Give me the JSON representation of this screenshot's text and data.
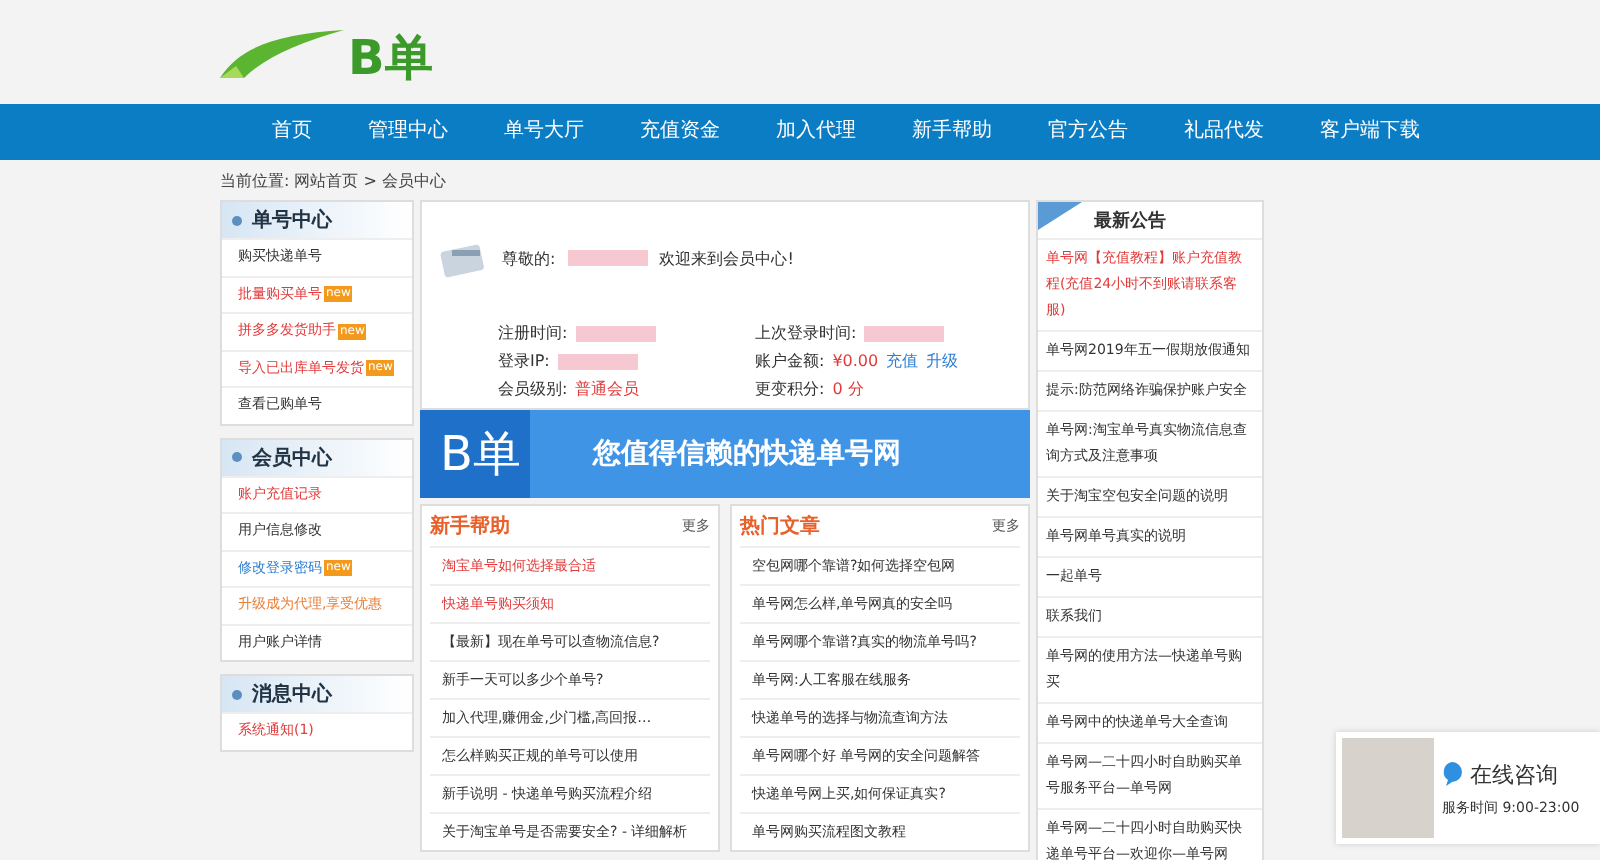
{
  "header": {
    "logo_text": "B单"
  },
  "nav": [
    {
      "label": "首页"
    },
    {
      "label": "管理中心"
    },
    {
      "label": "单号大厅"
    },
    {
      "label": "充值资金"
    },
    {
      "label": "加入代理"
    },
    {
      "label": "新手帮助"
    },
    {
      "label": "官方公告"
    },
    {
      "label": "礼品代发"
    },
    {
      "label": "客户端下载"
    }
  ],
  "breadcrumb": "当前位置: 网站首页 > 会员中心",
  "sidebar": [
    {
      "title": "单号中心",
      "items": [
        {
          "label": "购买快递单号",
          "color": "#333333"
        },
        {
          "label": "批量购买单号",
          "color": "#e23a3a",
          "badge": "new"
        },
        {
          "label": "拼多多发货助手",
          "color": "#e23a3a",
          "badge": "new"
        },
        {
          "label": "导入已出库单号发货",
          "color": "#e23a3a",
          "badge": "new"
        },
        {
          "label": "查看已购单号",
          "color": "#333333"
        }
      ]
    },
    {
      "title": "会员中心",
      "items": [
        {
          "label": "账户充值记录",
          "color": "#e23a3a"
        },
        {
          "label": "用户信息修改",
          "color": "#333333"
        },
        {
          "label": "修改登录密码",
          "color": "#2f7fd0",
          "badge": "new"
        },
        {
          "label": "升级成为代理,享受优惠",
          "color": "#e8803a"
        },
        {
          "label": "用户账户详情",
          "color": "#333333"
        }
      ]
    },
    {
      "title": "消息中心",
      "items": [
        {
          "label": "系统通知(1)",
          "color": "#e23a3a"
        }
      ]
    }
  ],
  "welcome": {
    "prefix": "尊敬的:",
    "suffix": "欢迎来到会员中心!"
  },
  "info": [
    {
      "label": "注册时间:"
    },
    {
      "label": "上次登录时间:"
    },
    {
      "label": "登录IP:"
    },
    {
      "label": "账户金额:",
      "value": "¥0.00",
      "links": [
        "充值",
        "升级"
      ]
    },
    {
      "label": "会员级别:",
      "value": "普通会员"
    },
    {
      "label": "更变积分:",
      "value": "0 分"
    }
  ],
  "banner": {
    "logo_text": "B单",
    "slogan": "您值得信赖的快递单号网"
  },
  "lists": [
    {
      "title": "新手帮助",
      "more": "更多",
      "items": [
        {
          "label": "淘宝单号如何选择最合适",
          "color": "#e23a3a"
        },
        {
          "label": "快递单号购买须知",
          "color": "#e23a3a"
        },
        {
          "label": "【最新】现在单号可以查物流信息?",
          "color": "#333333"
        },
        {
          "label": "新手一天可以多少个单号?",
          "color": "#333333"
        },
        {
          "label": "加入代理,赚佣金,少门槛,高回报…",
          "color": "#333333"
        },
        {
          "label": "怎么样购买正规的单号可以使用",
          "color": "#333333"
        },
        {
          "label": "新手说明 - 快递单号购买流程介绍",
          "color": "#333333"
        },
        {
          "label": "关于淘宝单号是否需要安全? - 详细解析",
          "color": "#333333"
        }
      ]
    },
    {
      "title": "热门文章",
      "more": "更多",
      "items": [
        {
          "label": "空包网哪个靠谱?如何选择空包网",
          "color": "#333333"
        },
        {
          "label": "单号网怎么样,单号网真的安全吗",
          "color": "#333333"
        },
        {
          "label": "单号网哪个靠谱?真实的物流单号吗?",
          "color": "#333333"
        },
        {
          "label": "单号网:人工客服在线服务",
          "color": "#333333"
        },
        {
          "label": "快递单号的选择与物流查询方法",
          "color": "#333333"
        },
        {
          "label": "单号网哪个好 单号网的安全问题解答",
          "color": "#333333"
        },
        {
          "label": "快递单号网上买,如何保证真实?",
          "color": "#333333"
        },
        {
          "label": "单号网购买流程图文教程",
          "color": "#333333"
        }
      ]
    }
  ],
  "notices": {
    "title": "最新公告",
    "items": [
      {
        "label": "单号网【充值教程】账户充值教程(充值24小时不到账请联系客服)",
        "color": "#e23a3a"
      },
      {
        "label": "单号网2019年五一假期放假通知",
        "color": "#333333"
      },
      {
        "label": "提示:防范网络诈骗保护账户安全",
        "color": "#333333"
      },
      {
        "label": "单号网:淘宝单号真实物流信息查询方式及注意事项",
        "color": "#333333"
      },
      {
        "label": "关于淘宝空包安全问题的说明",
        "color": "#333333"
      },
      {
        "label": "单号网单号真实的说明",
        "color": "#333333"
      },
      {
        "label": "一起单号",
        "color": "#333333"
      },
      {
        "label": "联系我们",
        "color": "#333333"
      },
      {
        "label": "单号网的使用方法—快递单号购买",
        "color": "#333333"
      },
      {
        "label": "单号网中的快递单号大全查询",
        "color": "#333333"
      },
      {
        "label": "单号网—二十四小时自助购买单号服务平台—单号网",
        "color": "#333333"
      },
      {
        "label": "单号网—二十四小时自助购买快递单号平台—欢迎你—单号网",
        "color": "#333333"
      }
    ]
  },
  "chat": {
    "title": "在线咨询",
    "hours": "服务时间 9:00-23:00"
  }
}
